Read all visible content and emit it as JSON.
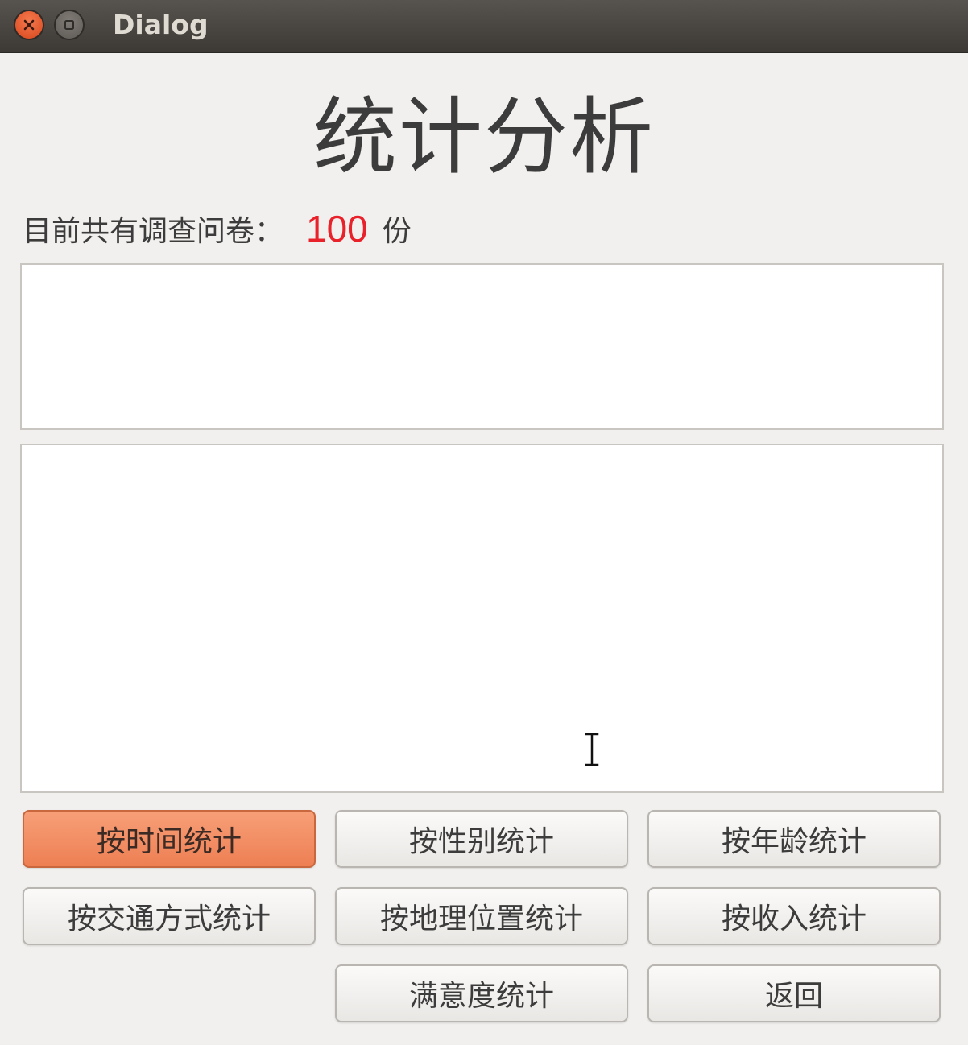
{
  "window": {
    "title": "Dialog"
  },
  "header": {
    "title": "统计分析",
    "count_label": "目前共有调查问卷：",
    "count_value": "100",
    "count_unit": "份"
  },
  "buttons": {
    "by_time": "按时间统计",
    "by_gender": "按性别统计",
    "by_age": "按年龄统计",
    "by_transport": "按交通方式统计",
    "by_location": "按地理位置统计",
    "by_income": "按收入统计",
    "by_satisfaction": "满意度统计",
    "back": "返回"
  },
  "colors": {
    "accent_active_button": "#ee7f53",
    "count_value": "#e8212a",
    "close_button": "#d9461c"
  },
  "icons": {
    "close": "close-icon",
    "maximize": "maximize-icon",
    "cursor": "text-cursor-icon"
  }
}
